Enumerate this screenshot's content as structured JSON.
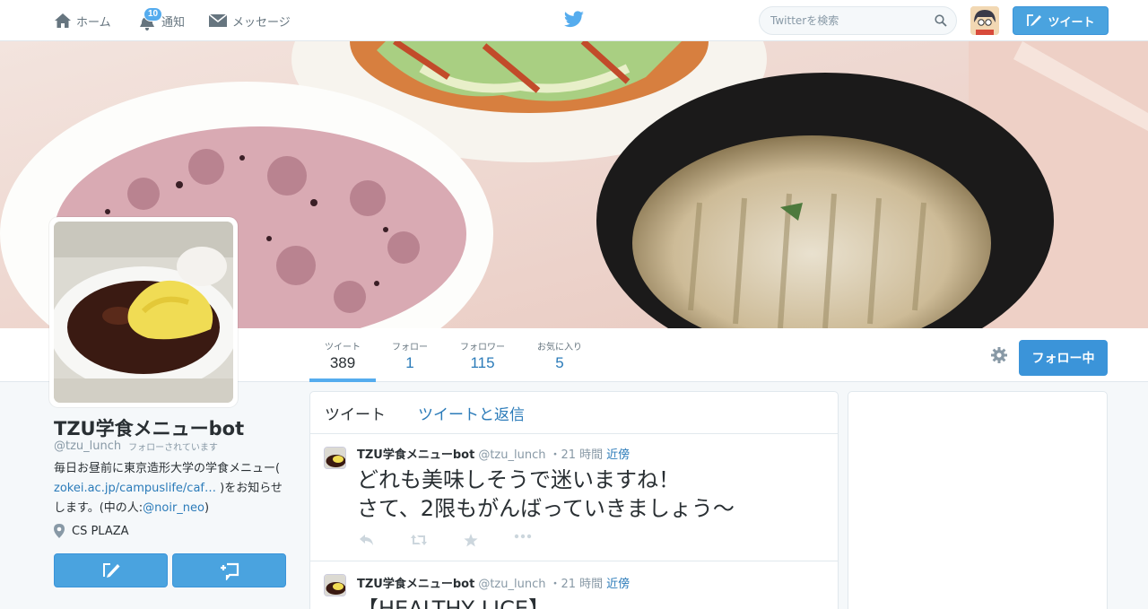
{
  "topnav": {
    "home_label": "ホーム",
    "notifications_label": "通知",
    "notifications_count": "10",
    "messages_label": "メッセージ",
    "search_placeholder": "Twitterを検索",
    "tweet_button_label": "ツイート"
  },
  "stats": {
    "tweets_label": "ツイート",
    "tweets_value": "389",
    "following_label": "フォロー",
    "following_value": "1",
    "followers_label": "フォロワー",
    "followers_value": "115",
    "favorites_label": "お気に入り",
    "favorites_value": "5"
  },
  "profile": {
    "name": "TZU学食メニューbot",
    "handle": "@tzu_lunch",
    "follows_you": "フォローされています",
    "bio_prefix": "毎日お昼前に東京造形大学の学食メニュー(",
    "bio_link": "zokei.ac.jp/campuslife/caf…",
    "bio_middle": ")をお知らせします。(中の人:",
    "bio_mention": "@noir_neo",
    "bio_suffix": ")",
    "location": "CS PLAZA",
    "follow_state_label": "フォロー中"
  },
  "timeline": {
    "tabs": [
      "ツイート",
      "ツイートと返信"
    ],
    "tweets": [
      {
        "name": "TZU学食メニューbot",
        "handle": "@tzu_lunch",
        "time": "・21 時間",
        "geo": "近傍",
        "text_line1": "どれも美味しそうで迷いますね！",
        "text_line2": "さて、2限もがんばっていきましょう〜"
      },
      {
        "name": "TZU学食メニューbot",
        "handle": "@tzu_lunch",
        "time": "・21 時間",
        "geo": "近傍",
        "text_line1": "【HEALTHY LICE】"
      }
    ]
  },
  "colors": {
    "accent": "#55acee",
    "link": "#2b7bb9",
    "button": "#4aa3df"
  },
  "icons": [
    "home-icon",
    "bell-icon",
    "envelope-icon",
    "twitter-bird-icon",
    "search-icon",
    "compose-icon",
    "gear-icon",
    "location-pin-icon",
    "direct-message-icon",
    "reply-icon",
    "retweet-icon",
    "favorite-star-icon",
    "more-icon"
  ]
}
